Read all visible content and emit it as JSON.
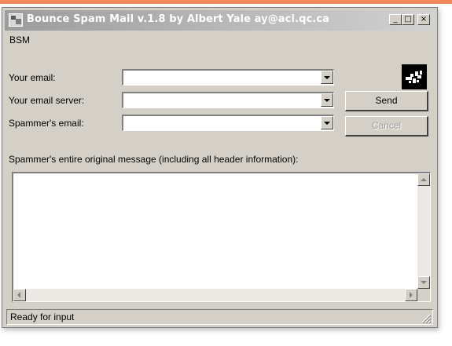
{
  "window": {
    "title": "Bounce Spam Mail v.1.8 by Albert Yale ay@aci.qc.ca",
    "controls": {
      "minimize": "_",
      "maximize": "□",
      "close": "×"
    }
  },
  "menu": {
    "items": [
      "BSM"
    ]
  },
  "form": {
    "your_email_label": "Your email:",
    "your_email_server_label": "Your email server:",
    "spammers_email_label": "Spammer's email:",
    "your_email_value": "",
    "your_email_server_value": "",
    "spammers_email_value": ""
  },
  "buttons": {
    "send": "Send",
    "cancel": "Cancel"
  },
  "message": {
    "label": "Spammer's entire original message (including all header information):",
    "value": ""
  },
  "status": {
    "text": "Ready for input"
  },
  "colors": {
    "accent": "#f08c5a",
    "face": "#d4d0c8"
  },
  "icons": [
    "app-icon",
    "logo-icon",
    "dropdown-arrow-icon",
    "scroll-up-icon",
    "scroll-down-icon",
    "scroll-left-icon",
    "scroll-right-icon",
    "size-grip-icon"
  ]
}
